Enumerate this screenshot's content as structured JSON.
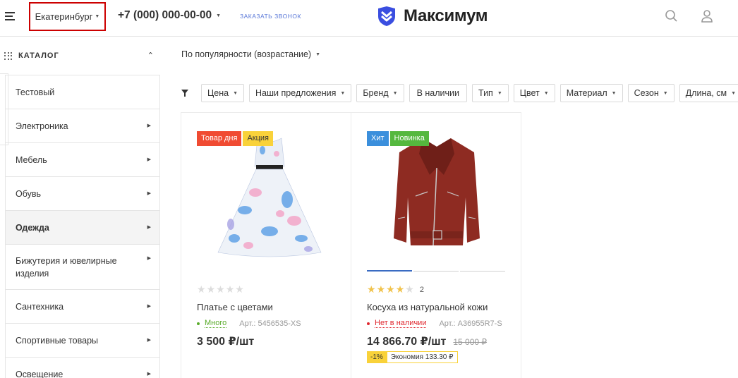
{
  "header": {
    "city": "Екатеринбург",
    "phone": "+7 (000) 000-00-00",
    "callback": "ЗАКАЗАТЬ ЗВОНОК",
    "logo": "Максимум",
    "brand_color": "#3a4ee0",
    "icons": [
      "menu-icon",
      "search-icon",
      "user-icon"
    ]
  },
  "sidebar": {
    "title": "КАТАЛОГ",
    "items": [
      {
        "label": "Тестовый"
      },
      {
        "label": "Электроника"
      },
      {
        "label": "Мебель"
      },
      {
        "label": "Обувь"
      },
      {
        "label": "Одежда"
      },
      {
        "label": "Бижутерия и ювелирные изделия"
      },
      {
        "label": "Сантехника"
      },
      {
        "label": "Спортивные товары"
      },
      {
        "label": "Освещение"
      }
    ]
  },
  "sort": {
    "label": "По популярности (возрастание)"
  },
  "filters": [
    "Цена",
    "Наши предложения",
    "Бренд",
    "В наличии",
    "Тип",
    "Цвет",
    "Материал",
    "Сезон",
    "Длина, см"
  ],
  "products": [
    {
      "badges": [
        {
          "label": "Товар дня",
          "color": "#f04b32"
        },
        {
          "label": "Акция",
          "color": "#f9d23a"
        }
      ],
      "rating": 0,
      "name": "Платье с цветами",
      "stock": "Много",
      "stock_color": "#5aac2b",
      "article": "Арт.: 5456535-XS",
      "price": "3 500 ₽/шт"
    },
    {
      "badges": [
        {
          "label": "Хит",
          "color": "#3b8fdc"
        },
        {
          "label": "Новинка",
          "color": "#55b83e"
        }
      ],
      "rating": 4,
      "reviews": "2",
      "name": "Косуха из натуральной кожи",
      "stock": "Нет в наличии",
      "stock_color": "#e0282f",
      "article": "Арт.: A36955R7-S",
      "price": "14 866.70 ₽/шт",
      "old_price": "15 000 ₽",
      "discount": "-1%",
      "economy": "Экономия 133.30 ₽"
    }
  ]
}
